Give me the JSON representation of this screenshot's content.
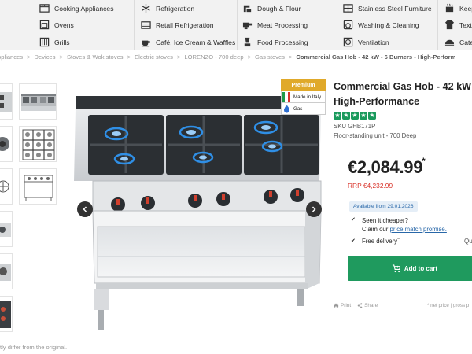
{
  "menu": {
    "items": [
      {
        "label": "Cooking Appliances",
        "icon": "cooking-appliances-icon"
      },
      {
        "label": "Refrigeration",
        "icon": "snowflake-icon"
      },
      {
        "label": "Dough & Flour",
        "icon": "dough-mixer-icon"
      },
      {
        "label": "Stainless Steel Furniture",
        "icon": "steel-furniture-icon"
      },
      {
        "label": "Keep",
        "icon": "keep-warm-icon"
      },
      {
        "label": "Ovens",
        "icon": "oven-icon"
      },
      {
        "label": "Retail Refrigeration",
        "icon": "retail-fridge-icon"
      },
      {
        "label": "Meat Processing",
        "icon": "meat-grinder-icon"
      },
      {
        "label": "Washing & Cleaning",
        "icon": "washing-machine-icon"
      },
      {
        "label": "Text",
        "icon": "textile-icon"
      },
      {
        "label": "Grills",
        "icon": "grill-icon"
      },
      {
        "label": "Café, Ice Cream & Waffles",
        "icon": "cafe-cup-icon"
      },
      {
        "label": "Food Processing",
        "icon": "food-processor-icon"
      },
      {
        "label": "Ventilation",
        "icon": "fan-icon"
      },
      {
        "label": "Cate",
        "icon": "catering-icon"
      }
    ]
  },
  "breadcrumb": {
    "items": [
      "ppliances",
      "Devices",
      "Stoves & Wok stoves",
      "Electric stoves",
      "LORENZO - 700 deep",
      "Gas stoves"
    ],
    "current": "Commercial Gas Hob - 42 kW - 6 Burners - High-Perform",
    "separator": ">"
  },
  "badges": {
    "premium": "Premium",
    "made_in": "Made in Italy",
    "gas": "Gas"
  },
  "product": {
    "title_line1": "Commercial Gas Hob - 42 kW -",
    "title_line2": "High-Performance",
    "rating": 5,
    "sku": "SKU GHB171P",
    "subline": "Floor-standing unit - 700 Deep",
    "price": "€2,084.99",
    "price_mark": "*",
    "rrp": "RRP €4,232.99",
    "availability": "Available from 29.01.2026",
    "feature1_line1": "Seen it cheaper?",
    "feature1_prefix": "Claim our ",
    "feature1_link": "price match promise.",
    "feature2": "Free delivery",
    "feature2_mark": "**",
    "qty_label": "Qu",
    "cart_label": "Add to cart",
    "print_label": "Print",
    "share_label": "Share",
    "net_note": "* net price | gross p"
  },
  "gallery": {
    "prev_icon": "chevron-left-icon",
    "next_icon": "chevron-right-icon"
  },
  "disclaimer": "tly differ from the original.",
  "colors": {
    "accent_green": "#1f9a5e",
    "star_green": "#1a9a5c",
    "rrp_red": "#d9332a",
    "link_blue": "#2867a8",
    "premium_gold": "#e0a92a",
    "menu_bg": "#f2f2f2"
  }
}
